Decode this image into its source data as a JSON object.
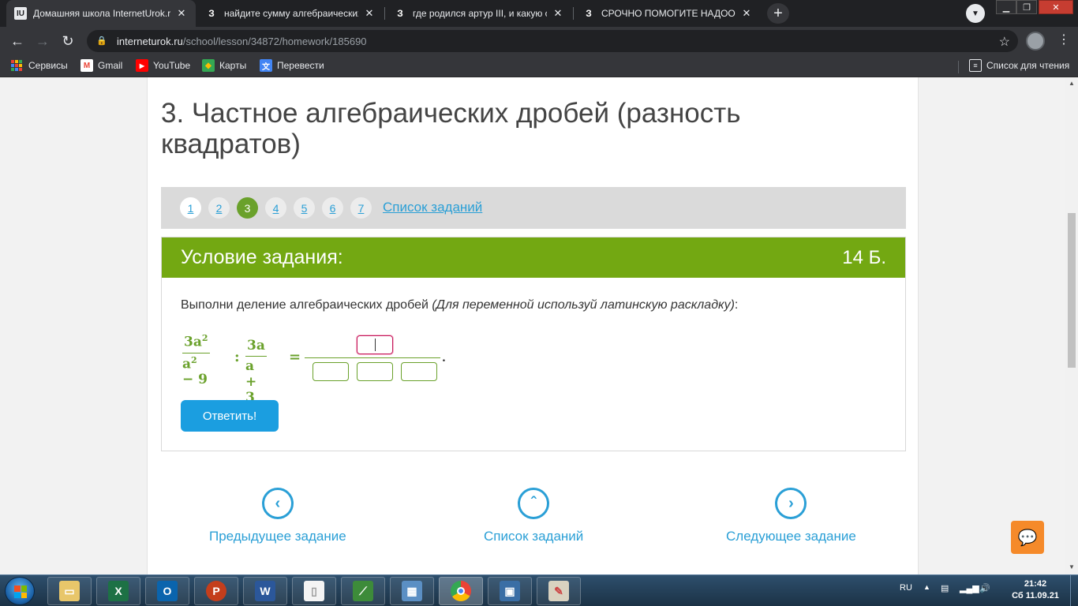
{
  "browser": {
    "tabs": [
      {
        "label": "Домашняя школа InternetUrok.ru",
        "favicon": "IU",
        "active": true
      },
      {
        "label": "найдите сумму алгебраических д",
        "favicon": "З",
        "active": false
      },
      {
        "label": "где родился артур III, и какую стр",
        "favicon": "З",
        "active": false
      },
      {
        "label": "СРОЧНО ПОМОГИТЕ НАДОООО",
        "favicon": "З",
        "active": false
      }
    ],
    "url_host": "interneturok.ru",
    "url_path": "/school/lesson/34872/homework/185690",
    "bookmarks": [
      {
        "label": "Сервисы",
        "icon": "apps-grid-icon"
      },
      {
        "label": "Gmail",
        "icon": "gmail-icon"
      },
      {
        "label": "YouTube",
        "icon": "youtube-icon"
      },
      {
        "label": "Карты",
        "icon": "maps-icon"
      },
      {
        "label": "Перевести",
        "icon": "translate-icon"
      }
    ],
    "reading_list": "Список для чтения"
  },
  "lesson": {
    "title": "3. Частное алгебраических дробей (разность квадратов)"
  },
  "pager": {
    "pages": [
      "1",
      "2",
      "3",
      "4",
      "5",
      "6",
      "7"
    ],
    "current": "3",
    "list_link": "Список заданий"
  },
  "task": {
    "header": "Условие задания:",
    "points": "14 Б.",
    "instruction_main": "Выполни деление алгебраических дробей ",
    "instruction_italic": "(Для переменной используй латинскую раскладку)",
    "instruction_end": ":",
    "formula": {
      "frac1_num": "3a",
      "frac1_num_exp": "2",
      "frac1_den": "a",
      "frac1_den_exp": "2",
      "frac1_den_rest": " − 9",
      "divide": ":",
      "frac2_num": "3a",
      "frac2_den": "a + 3",
      "equals": "=",
      "period": "."
    },
    "submit_label": "Ответить!"
  },
  "bottom_nav": {
    "prev": "Предыдущее задание",
    "list": "Список заданий",
    "next": "Следующее задание"
  },
  "taskbar": {
    "lang": "RU",
    "time": "21:42",
    "date": "Сб 11.09.21"
  },
  "colors": {
    "accent_green": "#73a812",
    "link_blue": "#2a9fd6",
    "button_blue": "#1b9ee0",
    "chat_orange": "#f58a2a"
  }
}
